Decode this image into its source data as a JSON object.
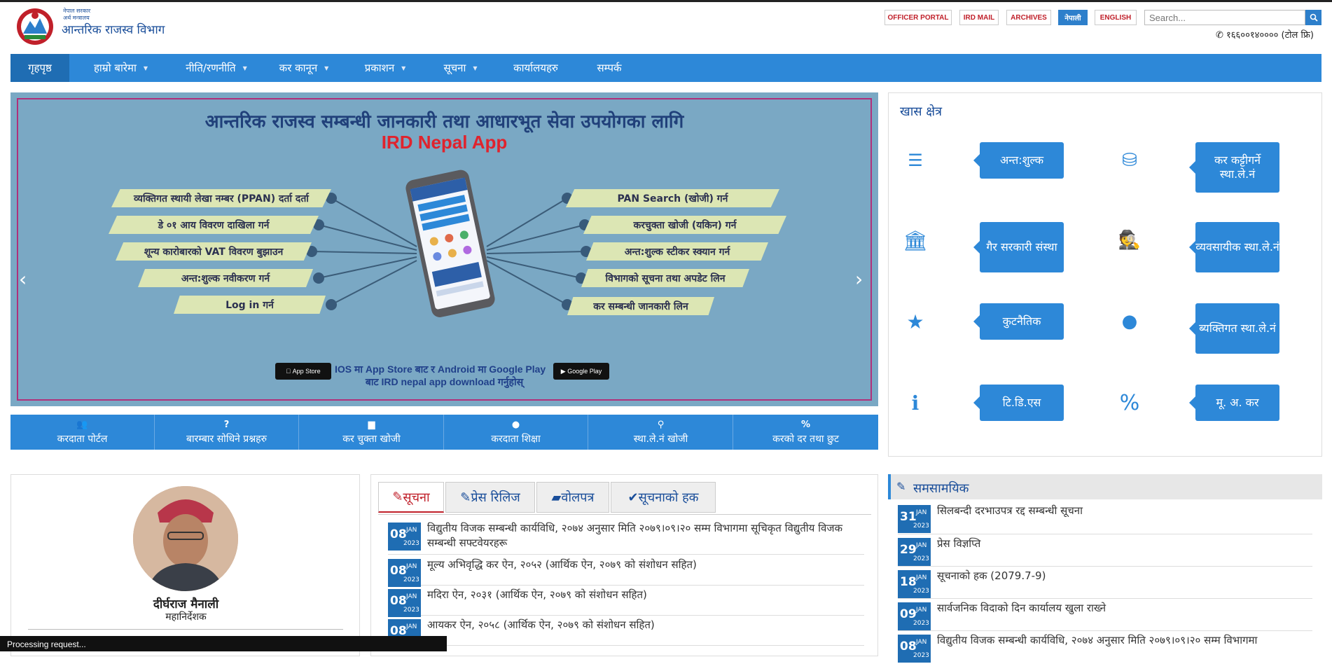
{
  "header": {
    "logo_small1": "नेपाल सरकार",
    "logo_small2": "अर्थ मन्त्रालय",
    "logo_title": "आन्तरिक राजस्व विभाग",
    "links": [
      "OFFICER PORTAL",
      "IRD MAIL",
      "ARCHIVES",
      "नेपाली",
      "ENGLISH"
    ],
    "search_placeholder": "Search...",
    "phone": "१६६००१४०००० (टोल फ्रि)"
  },
  "nav": {
    "items": [
      "गृहपृष्ठ",
      "हाम्रो बारेमा",
      "नीति/रणनीति",
      "कर कानून",
      "प्रकाशन",
      "सूचना",
      "कार्यालयहरु",
      "सम्पर्क"
    ]
  },
  "banner": {
    "title": "आन्तरिक राजस्व सम्बन्धी जानकारी तथा आधारभूत सेवा उपयोगका लागि",
    "app_name": "IRD Nepal App",
    "left_items": [
      "व्यक्तिगत स्थायी लेखा नम्बर (PPAN) दर्ता दर्ता",
      "डे ०१ आय विवरण दाखिला गर्न",
      "शून्य कारोबारको VAT विवरण बुझाउन",
      "अन्त:शुल्क नवीकरण गर्न",
      "Log in गर्न"
    ],
    "right_items": [
      "PAN Search (खोजी) गर्न",
      "करचुक्ता खोजी (यकिन) गर्न",
      "अन्त:शुल्क स्टीकर स्क्यान गर्न",
      "विभागको सूचना तथा अपडेट लिन",
      "कर सम्बन्धी जानकारी लिन"
    ],
    "store_line1": "IOS मा App Store बाट र Android मा Google Play",
    "store_line2": "बाट IRD nepal app download गर्नुहोस्",
    "app_store": "App Store",
    "google_play": "Google Play",
    "prev": "‹",
    "next": "›"
  },
  "quick_links": [
    {
      "icon": "users-icon",
      "glyph": "👥",
      "label": "करदाता पोर्टल"
    },
    {
      "icon": "question-icon",
      "glyph": "?",
      "label": "बारम्बार सोधिने प्रश्नहरु"
    },
    {
      "icon": "document-icon",
      "glyph": "▆",
      "label": "कर चुक्ता खोजी"
    },
    {
      "icon": "user-icon",
      "glyph": "●",
      "label": "करदाता शिक्षा"
    },
    {
      "icon": "search-icon",
      "glyph": "⚲",
      "label": "स्था.ले.नं खोजी"
    },
    {
      "icon": "percent-icon",
      "glyph": "%",
      "label": "करको दर तथा छुट"
    }
  ],
  "special": {
    "title": "खास क्षेत्र",
    "items": [
      {
        "icon": "server-icon",
        "label": "अन्त:शुल्क"
      },
      {
        "icon": "database-icon",
        "label": "कर कट्टीगर्ने स्था.ले.नं"
      },
      {
        "icon": "bank-icon",
        "label": "गैर सरकारी संस्था"
      },
      {
        "icon": "user-secret-icon",
        "label": "व्यवसायीक स्था.ले.नं"
      },
      {
        "icon": "star-icon",
        "label": "कुटनैतिक"
      },
      {
        "icon": "user-icon",
        "label": "ब्यक्तिगत स्था.ले.नं"
      },
      {
        "icon": "info-icon",
        "label": "टि.डि.एस"
      },
      {
        "icon": "percent-icon",
        "label": "मू. अ. कर"
      }
    ]
  },
  "profile": {
    "name": "दीर्घराज मैनाली",
    "role": "महानिर्देशक"
  },
  "notices": {
    "tabs": [
      "सूचना",
      "प्रेस रिलिज",
      "वोलपत्र",
      "सूचनाको हक"
    ],
    "rows": [
      {
        "day": "08",
        "mon": "JAN",
        "year": "2023",
        "text": "विद्युतीय विजक सम्बन्धी कार्यविधि, २०७४ अनुसार मिति २०७९।०९।२० सम्म विभागमा सूचिकृत विद्युतीय विजक सम्बन्धी सफ्टवेयरहरू"
      },
      {
        "day": "08",
        "mon": "JAN",
        "year": "2023",
        "text": "मूल्य अभिवृद्धि कर ऐन, २०५२ (आर्थिक ऐन, २०७९ को संशोधन सहित)"
      },
      {
        "day": "08",
        "mon": "JAN",
        "year": "2023",
        "text": "मदिरा ऐन, २०३१ (आर्थिक ऐन, २०७९ को संशोधन सहित)"
      },
      {
        "day": "08",
        "mon": "JAN",
        "year": "2023",
        "text": "आयकर ऐन, २०५८ (आर्थिक ऐन, २०७९ को संशोधन सहित)"
      }
    ]
  },
  "current": {
    "title": "समसामयिक",
    "rows": [
      {
        "day": "31",
        "mon": "JAN",
        "year": "2023",
        "text": "सिलबन्दी दरभाउपत्र रद्द सम्बन्धी सूचना"
      },
      {
        "day": "29",
        "mon": "JAN",
        "year": "2023",
        "text": "प्रेस विज्ञप्ति"
      },
      {
        "day": "18",
        "mon": "JAN",
        "year": "2023",
        "text": "सूचनाको हक (2079.7-9)"
      },
      {
        "day": "09",
        "mon": "JAN",
        "year": "2023",
        "text": "सार्वजनिक विदाको दिन कार्यालय खुला राख्ने"
      },
      {
        "day": "08",
        "mon": "JAN",
        "year": "2023",
        "text": "विद्युतीय विजक सम्बन्धी कार्यविधि, २०७४ अनुसार मिति २०७९।०९।२० सम्म विभागमा"
      }
    ]
  },
  "status_text": "Processing request...",
  "colors": {
    "primary": "#2d88d8",
    "dark_primary": "#1f6db3",
    "accent_red": "#c0202a",
    "banner_bg": "#7aa8c4"
  }
}
